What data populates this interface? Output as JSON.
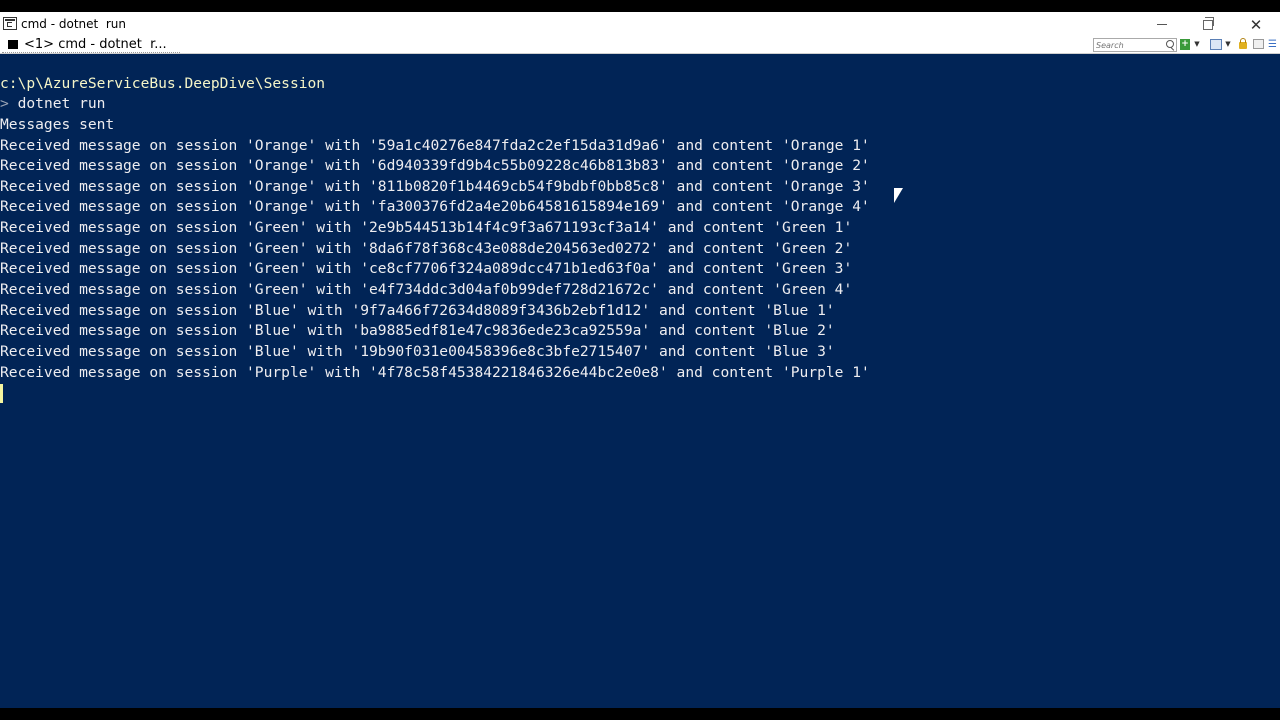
{
  "window": {
    "title": "cmd - dotnet  run"
  },
  "tab": {
    "label": "<1> cmd - dotnet  r..."
  },
  "search": {
    "placeholder": "Search"
  },
  "console": {
    "path": "c:\\p\\AzureServiceBus.DeepDive\\Session",
    "prompt_symbol": ">",
    "command": " dotnet run",
    "output": [
      "Messages sent",
      "Received message on session 'Orange' with '59a1c40276e847fda2c2ef15da31d9a6' and content 'Orange 1'",
      "Received message on session 'Orange' with '6d940339fd9b4c55b09228c46b813b83' and content 'Orange 2'",
      "Received message on session 'Orange' with '811b0820f1b4469cb54f9bdbf0bb85c8' and content 'Orange 3'",
      "Received message on session 'Orange' with 'fa300376fd2a4e20b64581615894e169' and content 'Orange 4'",
      "Received message on session 'Green' with '2e9b544513b14f4c9f3a671193cf3a14' and content 'Green 1'",
      "Received message on session 'Green' with '8da6f78f368c43e088de204563ed0272' and content 'Green 2'",
      "Received message on session 'Green' with 'ce8cf7706f324a089dcc471b1ed63f0a' and content 'Green 3'",
      "Received message on session 'Green' with 'e4f734ddc3d04af0b99def728d21672c' and content 'Green 4'",
      "Received message on session 'Blue' with '9f7a466f72634d8089f3436b2ebf1d12' and content 'Blue 1'",
      "Received message on session 'Blue' with 'ba9885edf81e47c9836ede23ca92559a' and content 'Blue 2'",
      "Received message on session 'Blue' with '19b90f031e00458396e8c3bfe2715407' and content 'Blue 3'",
      "Received message on session 'Purple' with '4f78c58f45384221846326e44bc2e0e8' and content 'Purple 1'"
    ]
  },
  "colors": {
    "console_background": "#012456",
    "console_text": "#eeedf0"
  },
  "icons": {
    "app": "console-app-icon",
    "search": "search-icon",
    "add": "add-console-icon",
    "lock": "lock-icon",
    "menu": "menu-icon"
  }
}
